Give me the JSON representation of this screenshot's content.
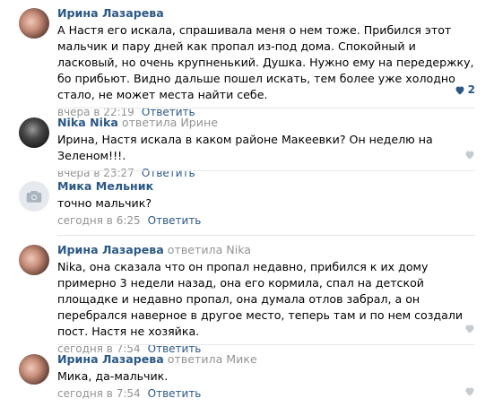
{
  "colors": {
    "link": "#2a5885",
    "muted": "#939393",
    "divider": "#e7e8ec",
    "heart_empty": "#c5cbd3"
  },
  "comments": [
    {
      "author": "Ирина Лазарева",
      "reply_to": "",
      "text": "А Настя его искала, спрашивала меня о нем тоже. Прибился этот мальчик и пару дней как пропал из-под дома. Спокойный и ласковый, но очень крупненький. Душка. Нужно ему на передержку, бо прибьют. Видно дальше пошел искать, тем более уже холодно стало, не может места найти себе.",
      "date": "вчера в 22:19",
      "reply_label": "Ответить",
      "likes": "2",
      "avatar_icon": "avatar-photo-icon"
    },
    {
      "author": "Nika Nika",
      "reply_to": "ответила Ирине",
      "text": "Ирина, Настя искала в каком районе Макеевки? Он неделю на Зеленом!!!.",
      "date": "вчера в 23:27",
      "reply_label": "Ответить",
      "likes": "",
      "avatar_icon": "avatar-photo-icon"
    },
    {
      "author": "Мика Мельник",
      "reply_to": "",
      "text": "точно мальчик?",
      "date": "сегодня в 6:25",
      "reply_label": "Ответить",
      "likes": "",
      "avatar_icon": "camera-icon"
    },
    {
      "author": "Ирина Лазарева",
      "reply_to": "ответила Nika",
      "text": "Nika, она сказала что он пропал недавно, прибился к их дому примерно 3 недели назад, она его кормила, спал на детской площадке и недавно пропал, она думала отлов забрал, а он перебрался наверное в другое место, теперь там и по нем создали пост. Настя не хозяйка.",
      "date": "сегодня в 7:54",
      "reply_label": "Ответить",
      "likes": "",
      "avatar_icon": "avatar-photo-icon"
    },
    {
      "author": "Ирина Лазарева",
      "reply_to": "ответила Мике",
      "text": "Мика, да-мальчик.",
      "date": "сегодня в 7:54",
      "reply_label": "Ответить",
      "likes": "",
      "avatar_icon": "avatar-photo-icon"
    }
  ]
}
